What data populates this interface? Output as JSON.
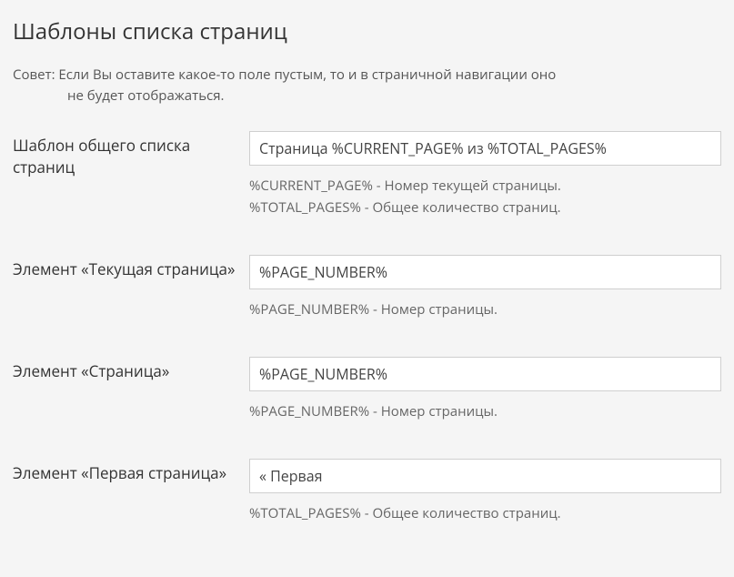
{
  "section": {
    "title": "Шаблоны списка страниц"
  },
  "tip": {
    "label": "Совет:",
    "text_line1": " Если Вы оставите какое-то поле пустым, то и в страничной навигации оно",
    "text_line2": "не будет отображаться."
  },
  "fields": {
    "overall": {
      "label": "Шаблон общего списка страниц",
      "value": "Страница %CURRENT_PAGE% из %TOTAL_PAGES%",
      "help1": "%CURRENT_PAGE% - Номер текущей страницы.",
      "help2": "%TOTAL_PAGES% - Общее количество страниц."
    },
    "current": {
      "label": "Элемент «Текущая страница»",
      "value": "%PAGE_NUMBER%",
      "help": "%PAGE_NUMBER% - Номер страницы."
    },
    "page": {
      "label": "Элемент «Страница»",
      "value": "%PAGE_NUMBER%",
      "help": "%PAGE_NUMBER% - Номер страницы."
    },
    "first": {
      "label": "Элемент «Первая страница»",
      "value": "« Первая",
      "help": "%TOTAL_PAGES% - Общее количество страниц."
    }
  }
}
